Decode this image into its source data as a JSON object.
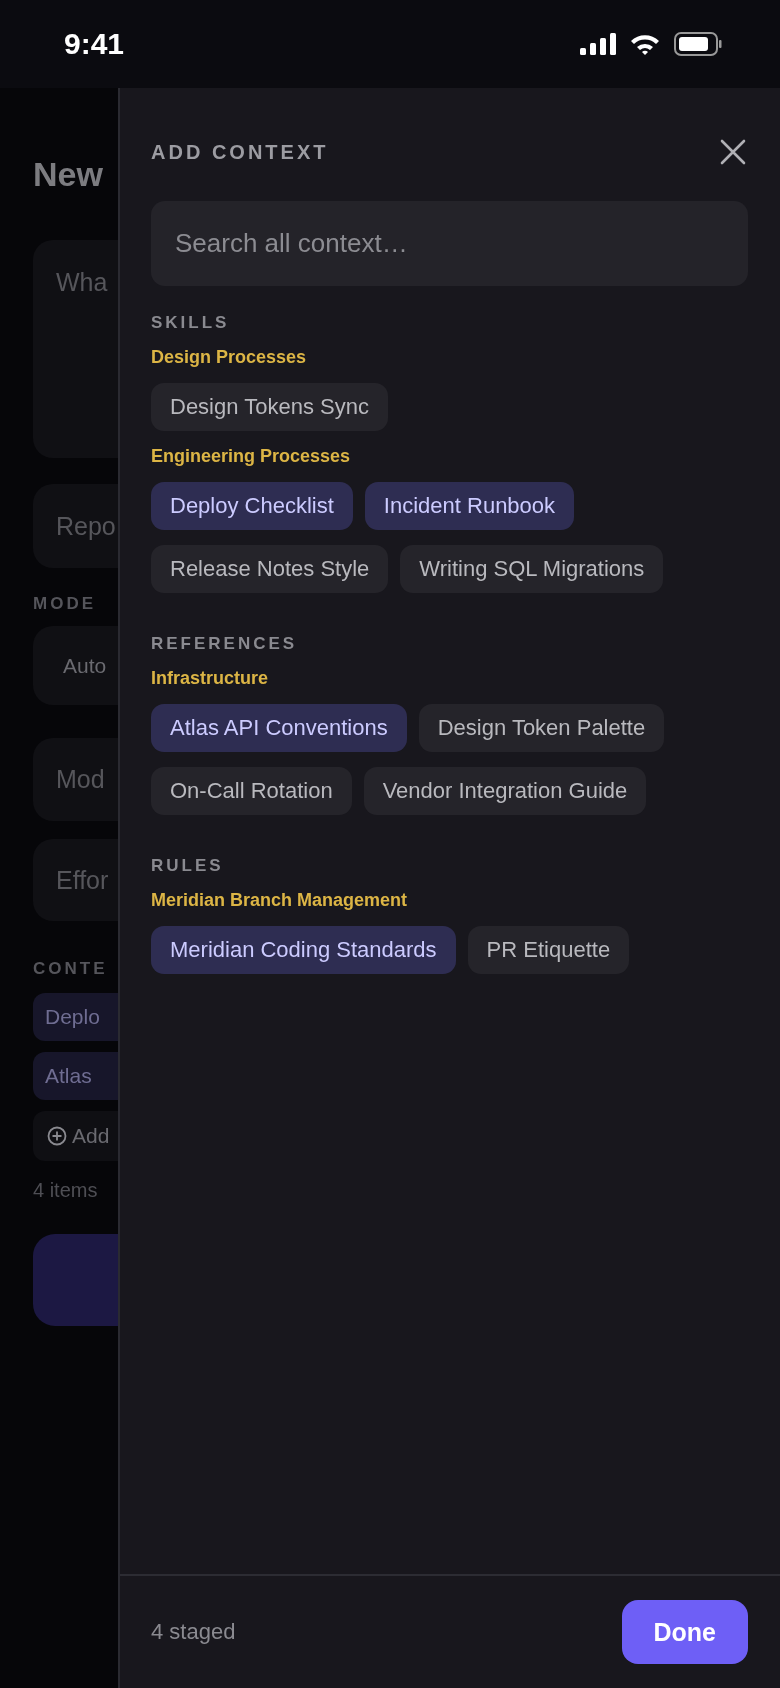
{
  "status_bar": {
    "time": "9:41"
  },
  "background": {
    "title": "New",
    "prompt_placeholder": "Wha",
    "repo": "Repo",
    "mode_label": "MODE",
    "mode": "Auto",
    "model": "Mod",
    "effort": "Effor",
    "context_label": "CONTE",
    "context_chips": [
      "Deplo",
      "Atlas"
    ],
    "add_label": "Add",
    "count": "4 items"
  },
  "sheet": {
    "title": "ADD CONTEXT",
    "search": {
      "placeholder": "Search all context…"
    },
    "sections": [
      {
        "label": "SKILLS",
        "groups": [
          {
            "name": "Design Processes",
            "items": [
              {
                "label": "Design Tokens Sync",
                "selected": false
              }
            ]
          },
          {
            "name": "Engineering Processes",
            "items": [
              {
                "label": "Deploy Checklist",
                "selected": true
              },
              {
                "label": "Incident Runbook",
                "selected": true
              },
              {
                "label": "Release Notes Style",
                "selected": false
              },
              {
                "label": "Writing SQL Migrations",
                "selected": false
              }
            ]
          }
        ]
      },
      {
        "label": "REFERENCES",
        "groups": [
          {
            "name": "Infrastructure",
            "items": [
              {
                "label": "Atlas API Conventions",
                "selected": true
              },
              {
                "label": "Design Token Palette",
                "selected": false
              },
              {
                "label": "On-Call Rotation",
                "selected": false
              },
              {
                "label": "Vendor Integration Guide",
                "selected": false
              }
            ]
          }
        ]
      },
      {
        "label": "RULES",
        "groups": [
          {
            "name": "Meridian Branch Management",
            "items": [
              {
                "label": "Meridian Coding Standards",
                "selected": true
              },
              {
                "label": "PR Etiquette",
                "selected": false
              }
            ]
          }
        ]
      }
    ],
    "footer": {
      "staged": "4 staged",
      "done": "Done"
    }
  }
}
